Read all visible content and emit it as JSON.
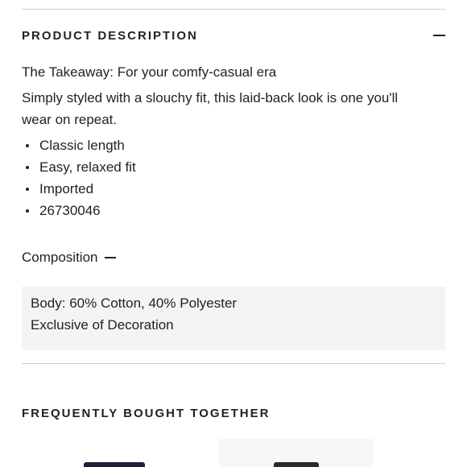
{
  "product_description": {
    "title": "PRODUCT DESCRIPTION",
    "takeaway": "The Takeaway: For your comfy-casual era",
    "summary_line1": "Simply styled with a slouchy fit, this laid-back look is one you'll",
    "summary_line2": "wear on repeat.",
    "bullets": [
      "Classic length",
      "Easy, relaxed fit",
      "Imported",
      "26730046"
    ]
  },
  "composition": {
    "label": "Composition",
    "lines": [
      "Body: 60% Cotton, 40% Polyester",
      "Exclusive of Decoration"
    ]
  },
  "frequently_bought": {
    "title": "FREQUENTLY BOUGHT TOGETHER",
    "items": [
      {
        "image": "navy-garment-thumbnail",
        "color": "#1c2138"
      },
      {
        "image": "dark-garment-thumbnail",
        "color": "#2a2a2a"
      }
    ]
  },
  "colors": {
    "text": "#222222",
    "divider": "#cfcfcf",
    "composition_bg": "#f4f4f4"
  },
  "icons": {
    "collapse": "minus-icon",
    "composition_toggle": "minus-icon"
  }
}
